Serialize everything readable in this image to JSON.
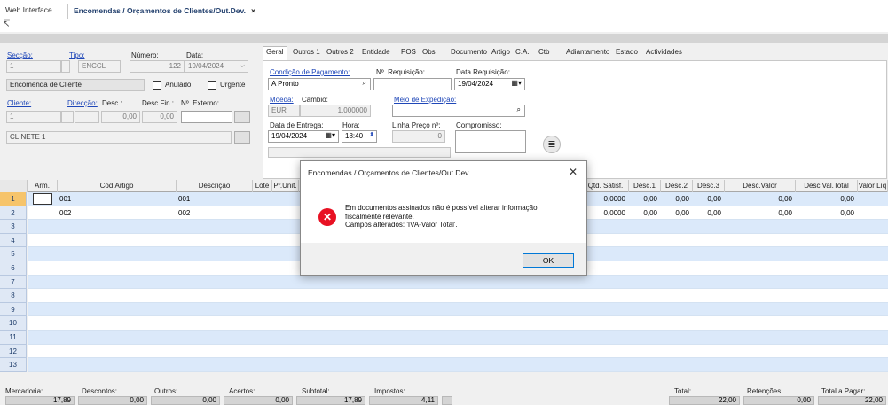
{
  "tabs": {
    "web": "Web Interface",
    "active": "Encomendas / Orçamentos de Clientes/Out.Dev.",
    "close": "×"
  },
  "left": {
    "seccao": "Secção:",
    "tipo": "Tipo:",
    "numero": "Número:",
    "data": "Data:",
    "seccao_val": "1",
    "tipo_val": "ENCCL",
    "numero_val": "122",
    "data_val": "19/04/2024",
    "doc_name": "Encomenda de Cliente",
    "anulado": "Anulado",
    "urgente": "Urgente",
    "cliente": "Cliente:",
    "direccao": "Direcção:",
    "desc": "Desc.:",
    "descfin": "Desc.Fin.:",
    "nexterno": "Nº. Externo:",
    "cliente_val": "1",
    "desc_val": "0,00",
    "descfin_val": "0,00",
    "cliente_nome": "CLINETE 1"
  },
  "right_tabs": [
    "Geral",
    "Outros 1",
    "Outros 2",
    "Entidade",
    "POS",
    "Obs",
    "Documento",
    "Artigo",
    "C.A.",
    "Ctb",
    "Adiantamento",
    "Estado",
    "Actividades"
  ],
  "geral": {
    "cond_pag": "Condição de Pagamento:",
    "cond_pag_val": "A Pronto",
    "nreq": "Nº. Requisição:",
    "data_req": "Data Requisição:",
    "data_req_val": "19/04/2024",
    "moeda": "Moeda:",
    "cambio": "Câmbio:",
    "moeda_val": "EUR",
    "cambio_val": "1,000000",
    "meio_exp": "Meio de Expedição:",
    "data_entrega": "Data de Entrega:",
    "hora": "Hora:",
    "linha_preco": "Linha Preço nº:",
    "compromisso": "Compromisso:",
    "data_entrega_val": "19/04/2024",
    "hora_val": "18:40",
    "linha_preco_val": "0"
  },
  "grid": {
    "headers": [
      "Arm.",
      "Cod.Artigo",
      "Descrição",
      "Lote",
      "Pr.Unit.",
      "Qtd. Satisf.",
      "Desc.1",
      "Desc.2",
      "Desc.3",
      "Desc.Valor",
      "Desc.Val.Total",
      "Valor Líq"
    ],
    "rows": [
      {
        "n": "1",
        "cod": "001",
        "desc": "001",
        "qtd": "0,0000",
        "d1": "0,00",
        "d2": "0,00",
        "d3": "0,00",
        "dv": "0,00",
        "dvt": "0,00"
      },
      {
        "n": "2",
        "cod": "002",
        "desc": "002",
        "qtd": "0,0000",
        "d1": "0,00",
        "d2": "0,00",
        "d3": "0,00",
        "dv": "0,00",
        "dvt": "0,00"
      }
    ],
    "row_numbers": [
      "1",
      "2",
      "3",
      "4",
      "5",
      "6",
      "7",
      "8",
      "9",
      "10",
      "11",
      "12",
      "13"
    ]
  },
  "footer": {
    "mercadoria": "Mercadoria:",
    "descontos": "Descontos:",
    "outros": "Outros:",
    "acertos": "Acertos:",
    "subtotal": "Subtotal:",
    "impostos": "Impostos:",
    "total": "Total:",
    "retencoes": "Retenções:",
    "total_pagar": "Total a Pagar:",
    "mercadoria_val": "17,89",
    "descontos_val": "0,00",
    "outros_val": "0,00",
    "acertos_val": "0,00",
    "subtotal_val": "17,89",
    "impostos_val": "4,11",
    "total_val": "22,00",
    "retencoes_val": "0,00",
    "total_pagar_val": "22,00"
  },
  "dialog": {
    "title": "Encomendas / Orçamentos de Clientes/Out.Dev.",
    "line1": "Em documentos assinados não é possível alterar informação",
    "line2": "fiscalmente relevante.",
    "line3": "Campos alterados: 'IVA-Valor Total'.",
    "ok": "OK"
  }
}
